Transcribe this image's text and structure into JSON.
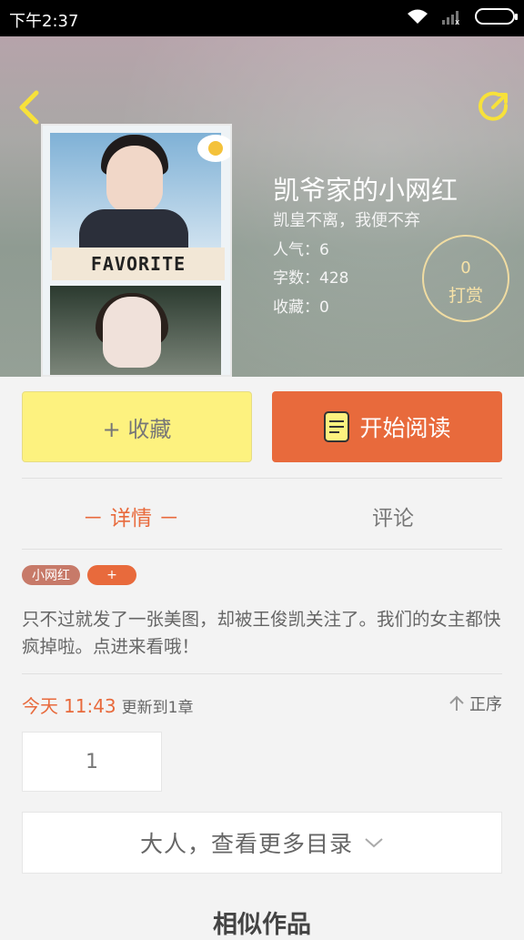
{
  "status_bar": {
    "time": "下午2:37"
  },
  "header": {
    "back_icon": "chevron-left-icon",
    "share_icon": "share-icon"
  },
  "cover": {
    "banner_text": "FAVORITE"
  },
  "book": {
    "title": "凯爷家的小网红",
    "subtitle": "凯皇不离，我便不弃",
    "popularity": "人气：6",
    "words": "字数：428",
    "favorites": "收藏：0"
  },
  "reward": {
    "count": "0",
    "label": "打赏"
  },
  "actions": {
    "favorite_label": "+ 收藏",
    "read_label": "开始阅读"
  },
  "tabs": {
    "details": "－ 详情 －",
    "comments": "评论"
  },
  "tags": [
    "小网红",
    "+"
  ],
  "description": "只不过就发了一张美图，却被王俊凯关注了。我们的女主都快疯掉啦。点进来看哦！",
  "update": {
    "day": "今天",
    "time": "11:43",
    "text": "更新到1章",
    "order_label": "正序"
  },
  "pages": {
    "current": "1"
  },
  "toc": {
    "label": "大人，查看更多目录"
  },
  "similar": {
    "title": "相似作品"
  },
  "colors": {
    "accent": "#e86a3c",
    "favorite_bg": "#fdf27f",
    "status_bar": "#000000"
  }
}
